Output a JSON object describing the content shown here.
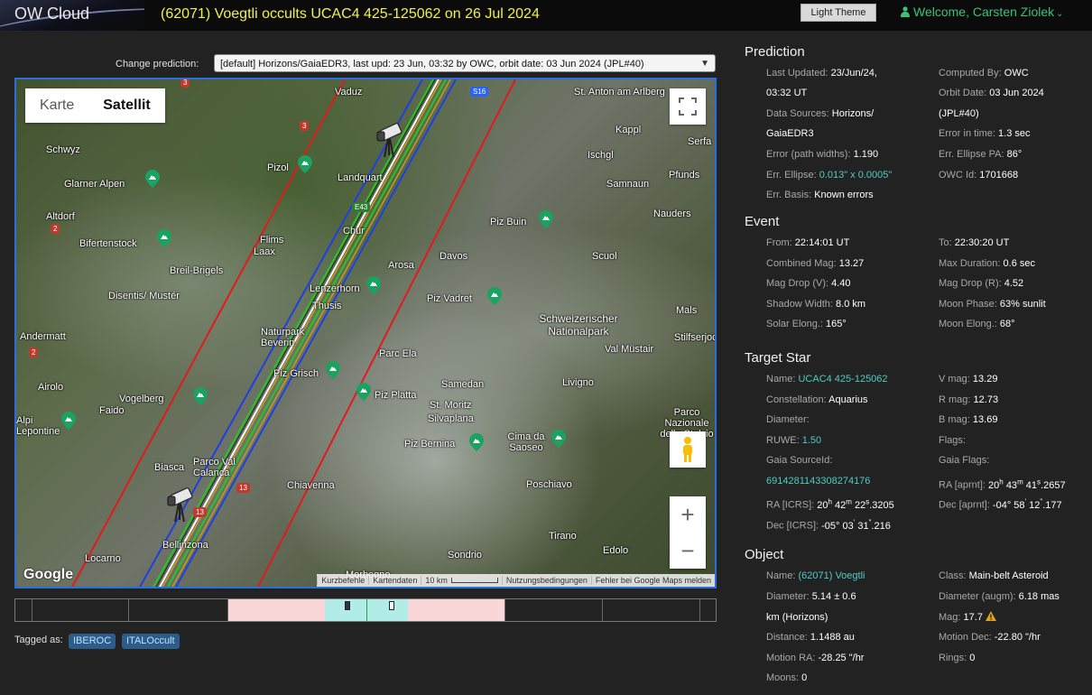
{
  "header": {
    "logo": "OW Cloud",
    "title": "(62071) Voegtli occults UCAC4 425-125062 on 26 Jul 2024",
    "theme_button": "Light Theme",
    "welcome": "Welcome, Carsten Ziolek"
  },
  "prediction_selector": {
    "label": "Change prediction:",
    "value": "[default] Horizons/GaiaEDR3, last upd: 23 Jun, 03:32 by OWC, orbit date: 03 Jun 2024 (JPL#40)"
  },
  "map": {
    "type_karte": "Karte",
    "type_satellit": "Satellit",
    "google": "Google",
    "attribution": [
      "Kurzbefehle",
      "Kartendaten",
      "10 km",
      "Nutzungsbedingungen",
      "Fehler bei Google Maps melden"
    ],
    "places": [
      "Vaduz",
      "St. Anton am Arlberg",
      "Schwyz",
      "Kappl",
      "Serfa",
      "Pizol",
      "Ischgl",
      "Landquart",
      "Pfunds",
      "Glarner Alpen",
      "Samnaun",
      "Altdorf",
      "Piz Buin",
      "Nauders",
      "Chur",
      "Flims",
      "Laax",
      "Bifertenstock",
      "Arosa",
      "Davos",
      "Scuol",
      "Breil-Brigels",
      "Lenzerhorn",
      "Disentis/ Mustér",
      "Thusis",
      "Piz Vadret",
      "Schweizerischer Nationalpark",
      "Mals",
      "Andermatt",
      "Naturpark Beverin",
      "Val Müstair",
      "Stilfserjoch",
      "Parc Ela",
      "Piz Grisch",
      "Airolo",
      "Samedan",
      "Livigno",
      "Vogelberg",
      "Piz Platta",
      "St. Moritz",
      "Faido",
      "Silvaplana",
      "Parco Nazionale dello Stelvio",
      "Alpi Lepontine",
      "Piz Bernina",
      "Cima da Saoseo",
      "Biasca",
      "Parco Val Calanca",
      "Chiavenna",
      "Poschiavo",
      "Bellinzona",
      "Locarno",
      "Sondrio",
      "Tirano",
      "Edolo",
      "Morbegno"
    ],
    "roads": [
      "3",
      "3",
      "2",
      "2",
      "13",
      "13",
      "S16",
      "E43"
    ]
  },
  "timeline": {},
  "tags": {
    "label": "Tagged as:",
    "items": [
      "IBEROC",
      "ITALOccult"
    ]
  },
  "prediction": {
    "title": "Prediction",
    "last_updated_label": "Last Updated:",
    "last_updated_value": "23/Jun/24,",
    "last_updated_value2": "03:32 UT",
    "computed_by_label": "Computed By:",
    "computed_by_value": "OWC",
    "data_sources_label": "Data Sources:",
    "data_sources_value": "Horizons/",
    "data_sources_value2": "GaiaEDR3",
    "orbit_date_label": "Orbit Date:",
    "orbit_date_value": "03 Jun 2024",
    "orbit_date_value2": "(JPL#40)",
    "error_path_label": "Error (path widths):",
    "error_path_value": "1.190",
    "error_time_label": "Error in time:",
    "error_time_value": "1.3 sec",
    "err_ellipse_label": "Err. Ellipse:",
    "err_ellipse_value": "0.013\" x 0.0005\"",
    "err_ellipse_pa_label": "Err. Ellipse PA:",
    "err_ellipse_pa_value": "86°",
    "owc_id_label": "OWC Id:",
    "owc_id_value": "1701668",
    "err_basis_label": "Err. Basis:",
    "err_basis_value": "Known errors"
  },
  "event": {
    "title": "Event",
    "from_label": "From:",
    "from_value": "22:14:01 UT",
    "to_label": "To:",
    "to_value": "22:30:20 UT",
    "combined_mag_label": "Combined Mag:",
    "combined_mag_value": "13.27",
    "max_duration_label": "Max Duration:",
    "max_duration_value": "0.6 sec",
    "mag_drop_v_label": "Mag Drop (V):",
    "mag_drop_v_value": "4.40",
    "mag_drop_r_label": "Mag Drop (R):",
    "mag_drop_r_value": "4.52",
    "shadow_width_label": "Shadow Width:",
    "shadow_width_value": "8.0 km",
    "moon_phase_label": "Moon Phase:",
    "moon_phase_value": "63% sunlit",
    "solar_elong_label": "Solar Elong.:",
    "solar_elong_value": "165°",
    "moon_elong_label": "Moon Elong.:",
    "moon_elong_value": "68°"
  },
  "target_star": {
    "title": "Target Star",
    "name_label": "Name:",
    "name_value": "UCAC4 425-125062",
    "v_mag_label": "V mag:",
    "v_mag_value": "13.29",
    "constellation_label": "Constellation:",
    "constellation_value": "Aquarius",
    "r_mag_label": "R mag:",
    "r_mag_value": "12.73",
    "diameter_label": "Diameter:",
    "b_mag_label": "B mag:",
    "b_mag_value": "13.69",
    "ruwe_label": "RUWE:",
    "ruwe_value": "1.50",
    "flags_label": "Flags:",
    "gaia_source_label": "Gaia SourceId:",
    "gaia_source_value": "6914281143308274176",
    "gaia_flags_label": "Gaia Flags:",
    "ra_aprnt_label": "RA [aprnt]:",
    "ra_aprnt_h": "20",
    "ra_aprnt_m": "43",
    "ra_aprnt_s": "41",
    "ra_aprnt_frac": ".2657",
    "ra_icrs_label": "RA [ICRS]:",
    "ra_icrs_h": "20",
    "ra_icrs_m": "42",
    "ra_icrs_s": "22",
    "ra_icrs_frac": ".3205",
    "dec_aprnt_label": "Dec [aprnt]:",
    "dec_aprnt_d": "-04° 58",
    "dec_aprnt_m": "12",
    "dec_aprnt_frac": ".177",
    "dec_icrs_label": "Dec [ICRS]:",
    "dec_icrs_d": "-05° 03",
    "dec_icrs_m": "31",
    "dec_icrs_frac": ".216"
  },
  "object": {
    "title": "Object",
    "name_label": "Name:",
    "name_value": "(62071) Voegtli",
    "class_label": "Class:",
    "class_value": "Main-belt Asteroid",
    "diameter_label": "Diameter:",
    "diameter_value": "5.14 ± 0.6",
    "diameter_value2": "km",
    "diameter_source": "(Horizons)",
    "diameter_augm_label": "Diameter (augm):",
    "diameter_augm_value": "6.18 mas",
    "mag_label": "Mag:",
    "mag_value": "17.7",
    "distance_label": "Distance:",
    "distance_value": "1.1488 au",
    "motion_dec_label": "Motion Dec:",
    "motion_dec_value": "-22.80 \"/hr",
    "motion_ra_label": "Motion RA:",
    "motion_ra_value": "-28.25 \"/hr",
    "rings_label": "Rings:",
    "rings_value": "0",
    "moons_label": "Moons:",
    "moons_value": "0"
  }
}
